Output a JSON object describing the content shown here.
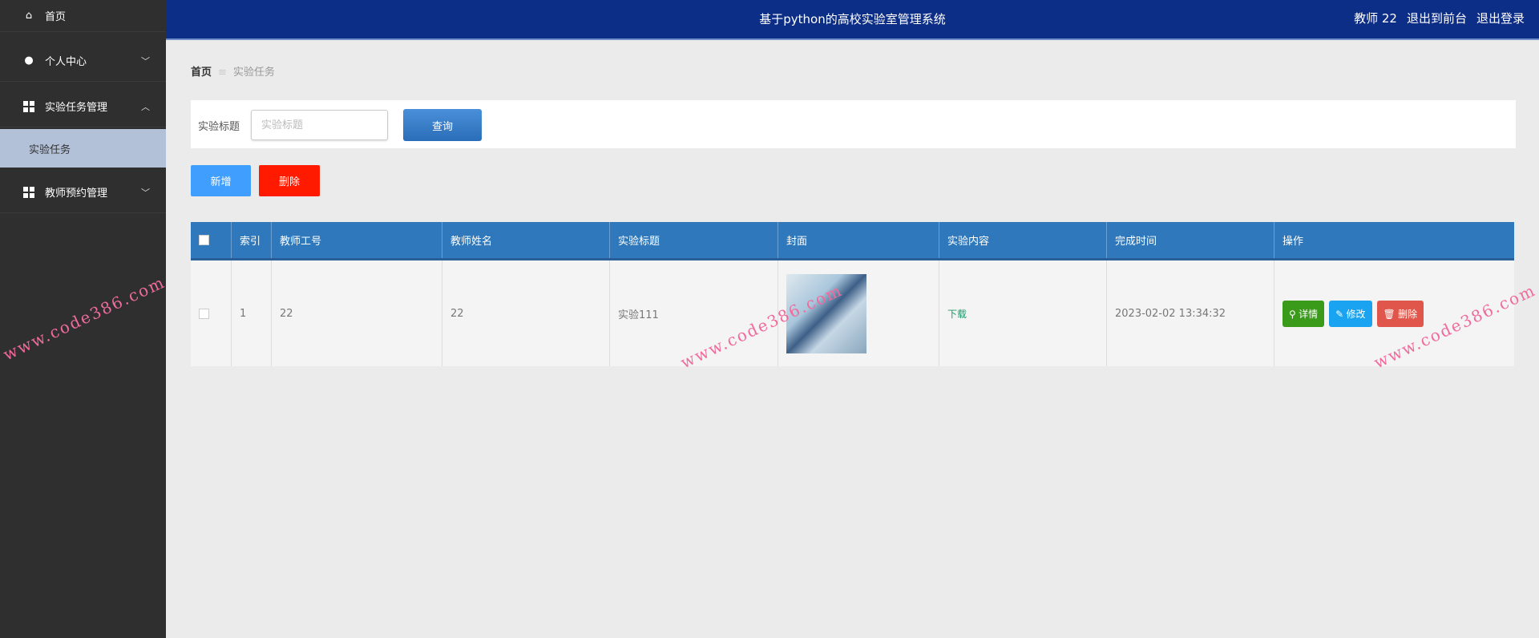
{
  "sidebar": {
    "items": [
      {
        "label": "首页",
        "icon": "home-icon"
      },
      {
        "label": "个人中心",
        "icon": "user-icon"
      },
      {
        "label": "实验任务管理",
        "icon": "grid-icon",
        "expanded": true,
        "children": [
          {
            "label": "实验任务",
            "active": true
          }
        ]
      },
      {
        "label": "教师预约管理",
        "icon": "grid-icon"
      }
    ]
  },
  "header": {
    "title": "基于python的高校实验室管理系统",
    "user": "教师 22",
    "front": "退出到前台",
    "logout": "退出登录"
  },
  "breadcrumb": {
    "home": "首页",
    "current": "实验任务"
  },
  "search": {
    "label": "实验标题",
    "placeholder": "实验标题",
    "value": "",
    "button": "查询"
  },
  "actions": {
    "add": "新增",
    "delete": "删除"
  },
  "table": {
    "headers": [
      "索引",
      "教师工号",
      "教师姓名",
      "实验标题",
      "封面",
      "实验内容",
      "完成时间",
      "操作"
    ],
    "rows": [
      {
        "index": "1",
        "teacher_id": "22",
        "teacher_name": "22",
        "title": "实验111",
        "content": "下载",
        "time": "2023-02-02 13:34:32"
      }
    ],
    "row_buttons": {
      "detail": "详情",
      "edit": "修改",
      "delete": "删除"
    }
  },
  "colors": {
    "header": "#0d2e86",
    "sidebar": "#2f2f2f",
    "table_head": "#2e78bb",
    "add": "#409eff",
    "delete": "#ff1a00",
    "detail": "#3a9a1a",
    "edit": "#1aa3f0",
    "row_delete": "#e0564a"
  },
  "watermark": "www.code386.com"
}
